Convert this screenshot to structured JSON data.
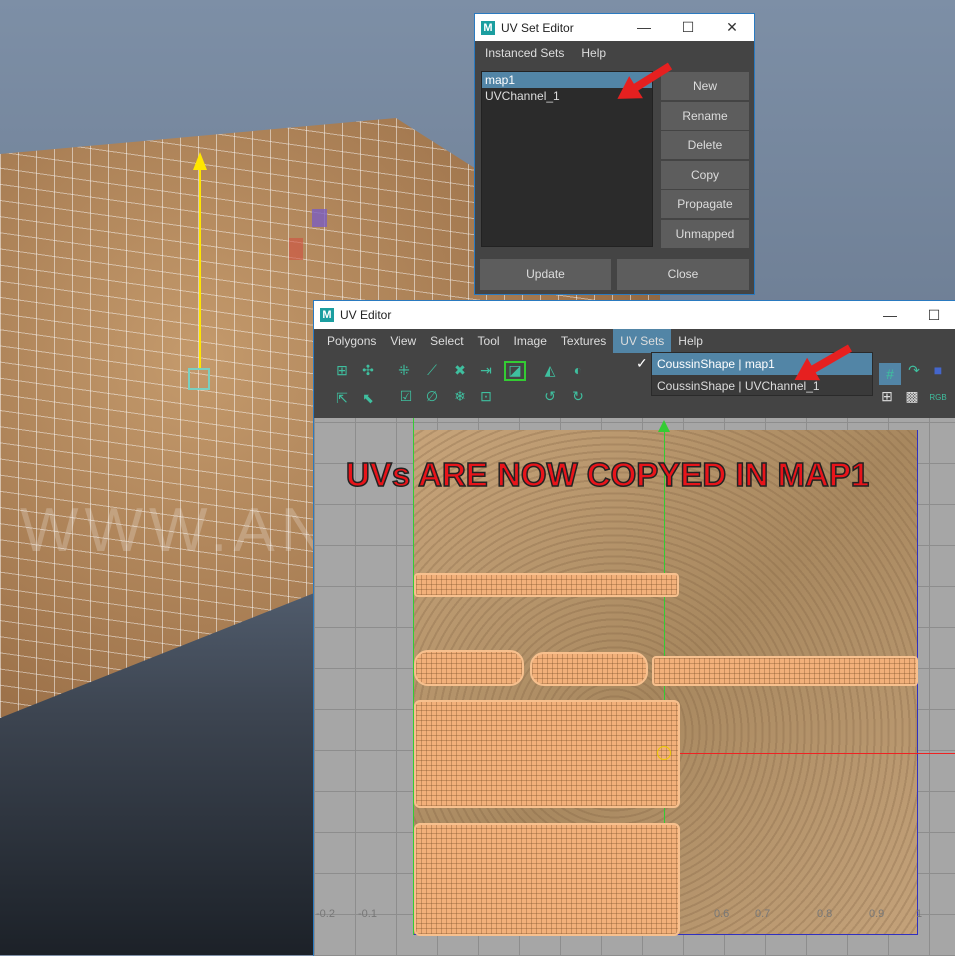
{
  "watermark": "WWW.ANTONIOBOSI.COM",
  "annotation": "UVs ARE NOW COPYED IN MAP1",
  "uv_set_editor": {
    "title": "UV Set Editor",
    "menu": [
      "Instanced Sets",
      "Help"
    ],
    "sets": [
      "map1",
      "UVChannel_1"
    ],
    "selected": "map1",
    "buttons": [
      "New",
      "Rename",
      "Delete",
      "Copy",
      "Propagate",
      "Unmapped"
    ],
    "update": "Update",
    "close": "Close",
    "minimize": "—",
    "maximize": "☐",
    "close_icon": "✕"
  },
  "uv_editor": {
    "title": "UV Editor",
    "minimize": "—",
    "maximize": "☐",
    "menu": [
      "Polygons",
      "View",
      "Select",
      "Tool",
      "Image",
      "Textures",
      "UV Sets",
      "Help"
    ],
    "active_menu": "UV Sets",
    "dropdown": {
      "check": "✓",
      "items": [
        "CoussinShape | map1",
        "CoussinShape | UVChannel_1"
      ],
      "checked": "CoussinShape | map1"
    },
    "ticks": [
      "-0.2",
      "-0.1",
      "0.6",
      "0.7",
      "0.8",
      "0.9",
      "1"
    ],
    "rgb_label": "RGB"
  },
  "colors": {
    "accent": "#5285a6",
    "arrow": "#e62020",
    "uv_shell": "#f2b07a",
    "icon": "#3fbf9f"
  }
}
